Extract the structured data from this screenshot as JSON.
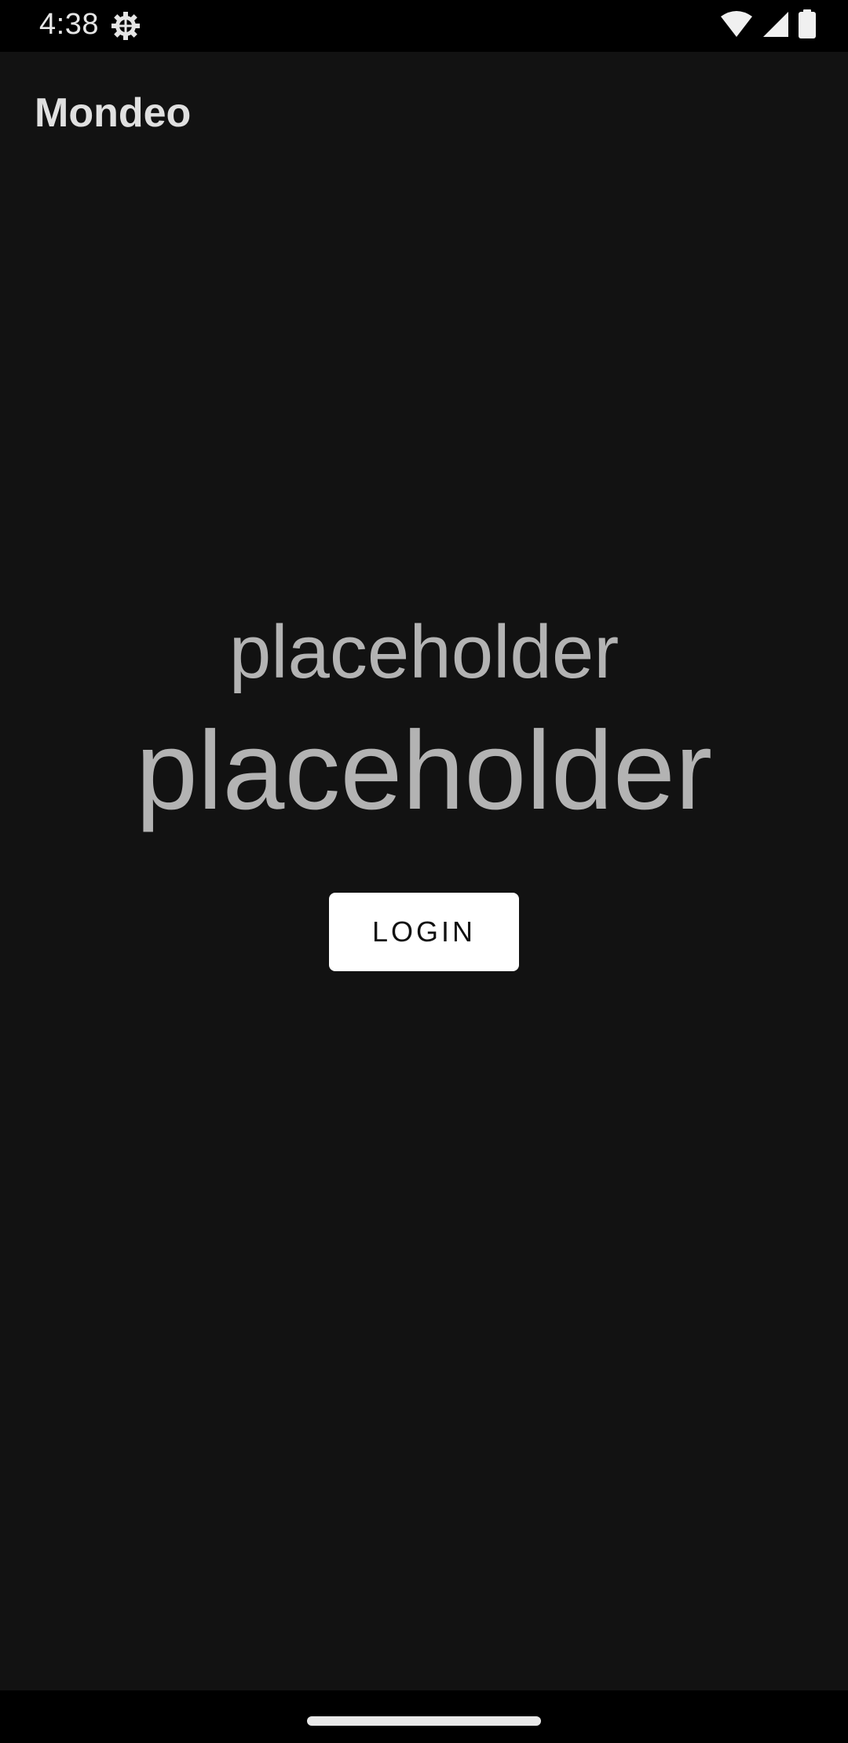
{
  "status_bar": {
    "time": "4:38",
    "icons": [
      "settings-gear-icon",
      "wifi-icon",
      "cell-signal-icon",
      "battery-icon"
    ]
  },
  "app": {
    "title": "Mondeo",
    "subtitle_text": "placeholder",
    "headline_text": "placeholder",
    "login_label": "LOGIN"
  },
  "colors": {
    "background": "#121212",
    "system_bars": "#000000",
    "text_primary": "#e0e0e0",
    "text_placeholder": "#b3b3b3",
    "button_bg": "#ffffff",
    "button_text": "#111111"
  }
}
